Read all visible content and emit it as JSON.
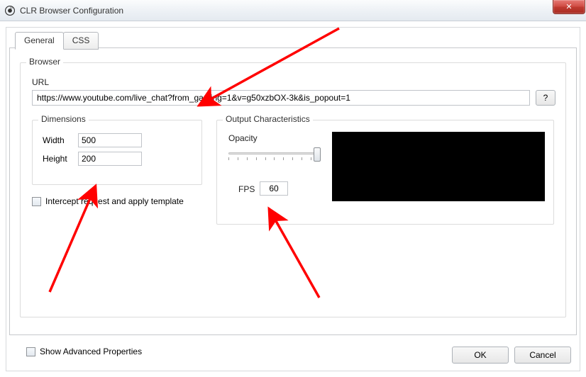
{
  "window": {
    "title": "CLR Browser Configuration",
    "close_glyph": "✕"
  },
  "tabs": {
    "general": "General",
    "css": "CSS"
  },
  "browser": {
    "legend": "Browser",
    "url_label": "URL",
    "url_value": "https://www.youtube.com/live_chat?from_gaming=1&v=g50xzbOX-3k&is_popout=1",
    "help_label": "?",
    "intercept_label": "Intercept request and apply template"
  },
  "dimensions": {
    "legend": "Dimensions",
    "width_label": "Width",
    "width_value": "500",
    "height_label": "Height",
    "height_value": "200"
  },
  "output": {
    "legend": "Output Characteristics",
    "opacity_label": "Opacity",
    "fps_label": "FPS",
    "fps_value": "60"
  },
  "advanced_label": "Show Advanced Properties",
  "footer": {
    "ok": "OK",
    "cancel": "Cancel"
  }
}
